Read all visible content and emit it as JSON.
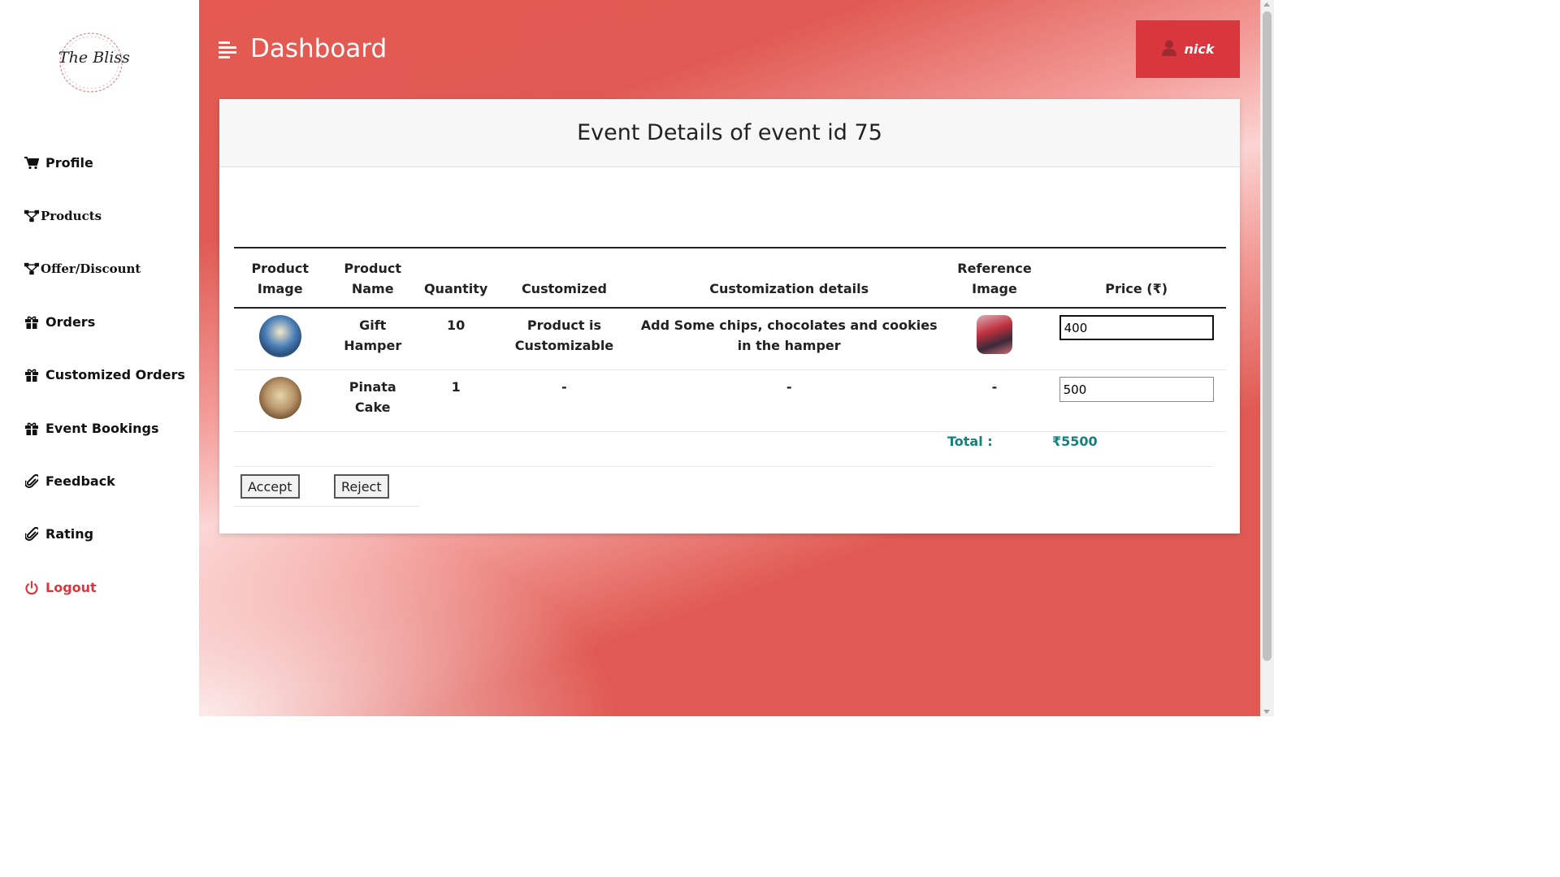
{
  "sidebar": {
    "logo_text": "The Bliss",
    "items": [
      {
        "label": "Profile",
        "icon": "cart-icon"
      },
      {
        "label": "Products",
        "icon": "sitemap-icon"
      },
      {
        "label": "Offer/Discount",
        "icon": "sitemap-icon"
      },
      {
        "label": "Orders",
        "icon": "gift-icon"
      },
      {
        "label": "Customized Orders",
        "icon": "gift-icon"
      },
      {
        "label": "Event Bookings",
        "icon": "gift-icon"
      },
      {
        "label": "Feedback",
        "icon": "paperclip-icon"
      },
      {
        "label": "Rating",
        "icon": "paperclip-icon"
      },
      {
        "label": "Logout",
        "icon": "power-icon"
      }
    ]
  },
  "header": {
    "title": "Dashboard",
    "user": "nick"
  },
  "card": {
    "title": "Event Details of event id 75"
  },
  "table": {
    "headers": [
      "Product Image",
      "Product Name",
      "Quantity",
      "Customized",
      "Customization details",
      "Reference Image",
      "Price (₹)"
    ],
    "rows": [
      {
        "name": "Gift Hamper",
        "quantity": "10",
        "customized": "Product is Customizable",
        "details": "Add Some chips, chocolates and cookies in the hamper",
        "reference": "",
        "price": "400"
      },
      {
        "name": "Pinata Cake",
        "quantity": "1",
        "customized": "-",
        "details": "-",
        "reference": "-",
        "price": "500"
      }
    ]
  },
  "total": {
    "label": "Total :",
    "value": "₹5500"
  },
  "actions": {
    "accept": "Accept",
    "reject": "Reject"
  },
  "colors": {
    "accent": "#d9363e",
    "total": "#16807d"
  }
}
